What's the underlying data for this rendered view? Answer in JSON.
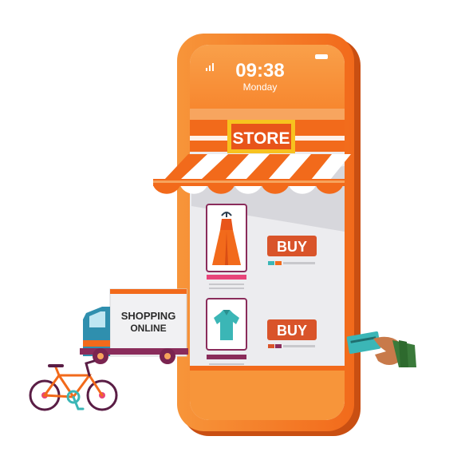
{
  "status_bar": {
    "time": "09:38",
    "day": "Monday"
  },
  "store_sign": "STORE",
  "products": [
    {
      "item": "dress-icon",
      "buy_label": "BUY"
    },
    {
      "item": "shirt-icon",
      "buy_label": "BUY"
    }
  ],
  "truck": {
    "line1": "SHOPPING",
    "line2": "ONLINE"
  },
  "colors": {
    "orange": "#f26a1b",
    "orange_light": "#f7a35c",
    "buy_red": "#d9542a",
    "teal": "#3bb6b6",
    "purple": "#8a2c5b",
    "pink": "#e8457a"
  }
}
